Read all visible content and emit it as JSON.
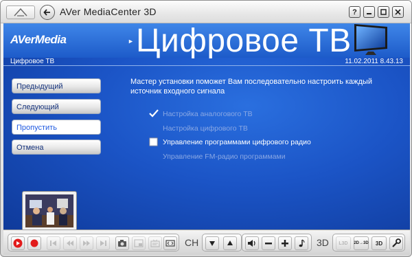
{
  "window": {
    "title": "AVer MediaCenter 3D"
  },
  "titlebar": {
    "help_symbol": "?"
  },
  "header": {
    "brand": "AVerMedia",
    "brand_separator": "►",
    "title": "Цифровое ТВ"
  },
  "info_bar": {
    "section": "Цифровое ТВ",
    "datetime": "11.02.2011 8.43.13"
  },
  "menu": {
    "items": [
      {
        "label": "Предыдущий"
      },
      {
        "label": "Следующий"
      },
      {
        "label": "Пропустить"
      },
      {
        "label": "Отмена"
      }
    ]
  },
  "wizard": {
    "intro": "Мастер установки поможет Вам последовательно настроить каждый источник входного сигнала",
    "options": [
      {
        "label": "Настройка аналогового ТВ",
        "state": "done"
      },
      {
        "label": "Настройка цифрового ТВ",
        "state": "pending"
      },
      {
        "label": "Управление программами цифрового радио",
        "state": "current"
      },
      {
        "label": "Управление FM-радио программами",
        "state": "pending"
      }
    ]
  },
  "toolbar": {
    "ch_label": "CH",
    "mode_label": "3D",
    "badge_2d3d": "2D→3D",
    "badge_3d": "3D",
    "badge_l3d": "L3D"
  },
  "colors": {
    "accent_blue": "#1b54c6",
    "record_red": "#e21b1b"
  }
}
